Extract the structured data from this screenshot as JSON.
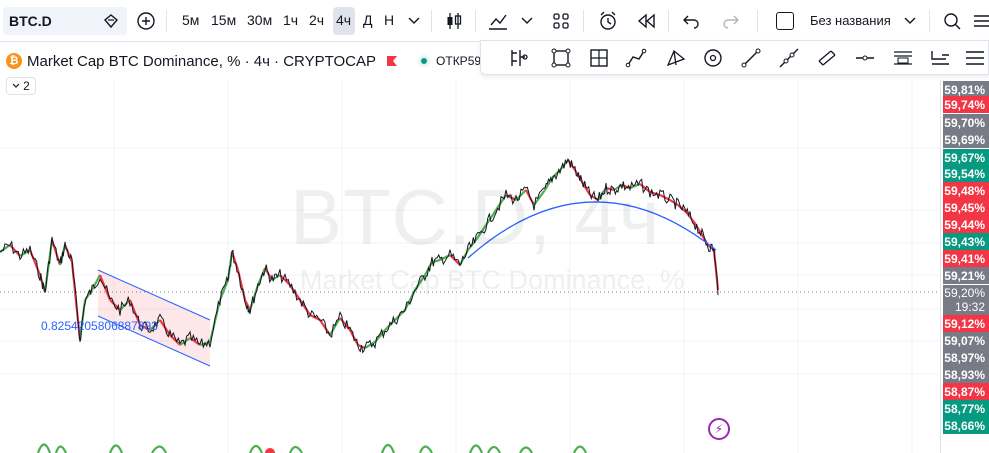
{
  "toolbar": {
    "symbol": "BTC.D",
    "timeframes": [
      "5м",
      "15м",
      "30м",
      "1ч",
      "2ч",
      "4ч",
      "Д",
      "Н"
    ],
    "active_timeframe": "4ч",
    "layout_name": "Без названия"
  },
  "legend": {
    "title": "Market Cap BTC Dominance, % · 4ч · CRYPTOCAP",
    "open_label": "ОТКР59",
    "collapse_count": "2",
    "logo_letter": "₿"
  },
  "drawing_tools": [
    "long-position-icon",
    "rectangle-icon",
    "crosshair-box-icon",
    "path-icon",
    "triangle-pattern-icon",
    "circle-target-icon",
    "trend-line-icon",
    "ray-icon",
    "channel-icon",
    "horizontal-line-icon",
    "text-note-icon",
    "price-label-icon",
    "menu-lines-icon"
  ],
  "chart": {
    "watermark": "BTC.D, 4ч",
    "watermark_sub": "Market Cap BTC Dominance, %",
    "fib_label": "0.8254205806887893",
    "colors": {
      "up": "#4caf50",
      "down": "#f23645",
      "curve": "#2962ff",
      "price_line": "#787b86"
    }
  },
  "price_scale": {
    "labels": [
      {
        "text": "59,81%",
        "color": "#787b86"
      },
      {
        "text": "59,74%",
        "color": "#f23645"
      },
      {
        "text": "59,70%",
        "color": "#787b86"
      },
      {
        "text": "59,69%",
        "color": "#787b86"
      },
      {
        "text": "59,67%",
        "color": "#089981"
      },
      {
        "text": "59,54%",
        "color": "#089981"
      },
      {
        "text": "59,48%",
        "color": "#f23645"
      },
      {
        "text": "59,45%",
        "color": "#f23645"
      },
      {
        "text": "59,44%",
        "color": "#f23645"
      },
      {
        "text": "59,43%",
        "color": "#089981"
      },
      {
        "text": "59,41%",
        "color": "#f23645"
      },
      {
        "text": "59,21%",
        "color": "#787b86"
      },
      {
        "text": "59,12%",
        "color": "#f23645"
      },
      {
        "text": "59,07%",
        "color": "#787b86"
      },
      {
        "text": "58,97%",
        "color": "#787b86"
      },
      {
        "text": "58,93%",
        "color": "#787b86"
      },
      {
        "text": "58,87%",
        "color": "#f23645"
      },
      {
        "text": "58,77%",
        "color": "#089981"
      },
      {
        "text": "58,66%",
        "color": "#089981"
      }
    ],
    "current_price": "59,20%",
    "countdown": "19:32"
  }
}
